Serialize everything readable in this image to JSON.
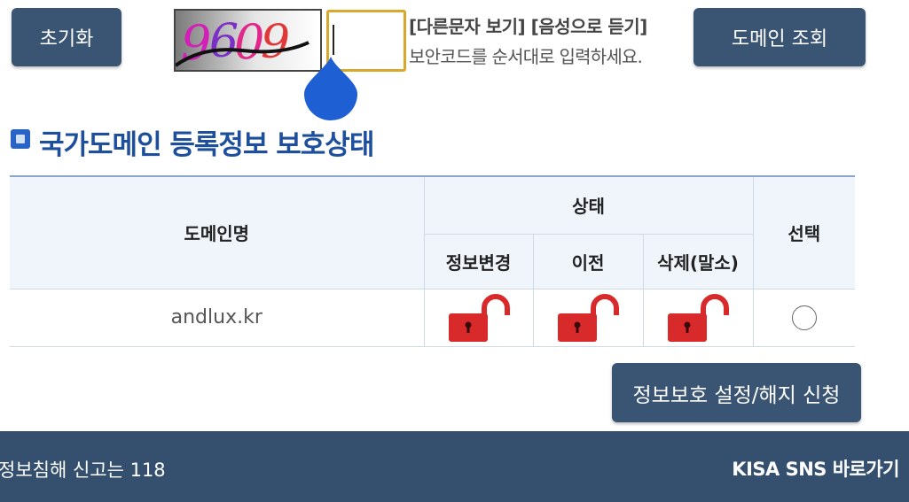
{
  "buttons": {
    "reset": "초기화",
    "lookup": "도메인 조회",
    "apply": "정보보호 설정/해지 신청"
  },
  "captcha": {
    "code": "9609",
    "input_value": "",
    "other_char": "[다른문자 보기]",
    "audio": "[음성으로 듣기]",
    "hint": "보안코드를 순서대로 입력하세요."
  },
  "section": {
    "title": "국가도메인 등록정보 보호상태"
  },
  "table": {
    "headers": {
      "domain": "도메인명",
      "status": "상태",
      "info_change": "정보변경",
      "transfer": "이전",
      "delete": "삭제(말소)",
      "select": "선택"
    },
    "rows": [
      {
        "domain": "andlux.kr",
        "info_change": "unlocked-icon",
        "transfer": "unlocked-icon",
        "delete": "unlocked-icon",
        "selected": false
      }
    ]
  },
  "footer": {
    "report": "정보침해 신고는 118",
    "sns": "KISA SNS 바로가기"
  },
  "colors": {
    "button": "#3a5573",
    "footer": "#34506e",
    "title": "#1d4f9c",
    "lock": "#d82a2a",
    "captcha_border": "#d9a72b",
    "drop_handle": "#1e5fd4"
  }
}
